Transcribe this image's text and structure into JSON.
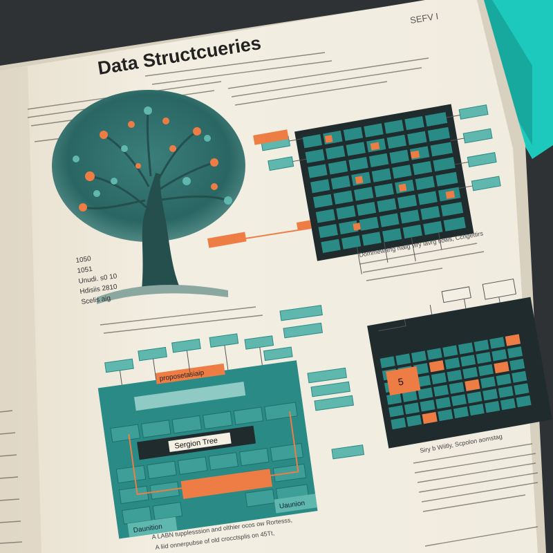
{
  "book": {
    "heading": "Data Structcueries",
    "corner_label": "SEFV I",
    "tree_diagram_label": "Sergion Tree",
    "orange_block_label": "proposetasiaip",
    "bottom_left_box_label": "Daunition",
    "bottom_right_box_label": "Uaunion",
    "small_orange_box_label": "5",
    "bullet_items": [
      "1050",
      "1051",
      "Unudi. s0 10",
      "Hdisiis 2810",
      "Scelis aig"
    ],
    "caption_left": "A LABN tupplesssion and olthier ocos ow Rortesss,",
    "caption_left_2": "A liid onnerpubse of old crocctsplis on 45Tt,",
    "caption_mid": "Dommewarfg nialg viry lavrg tiows, Ccngettirs",
    "caption_right": "Siry b Wiitly, Scpolon aomstag"
  },
  "colors": {
    "teal": "#2a8a85",
    "teal_light": "#5fb7ae",
    "orange": "#ee7d45",
    "paper": "#f1ebde",
    "dark": "#1f2b2d",
    "spine": "#1dc9bd"
  }
}
